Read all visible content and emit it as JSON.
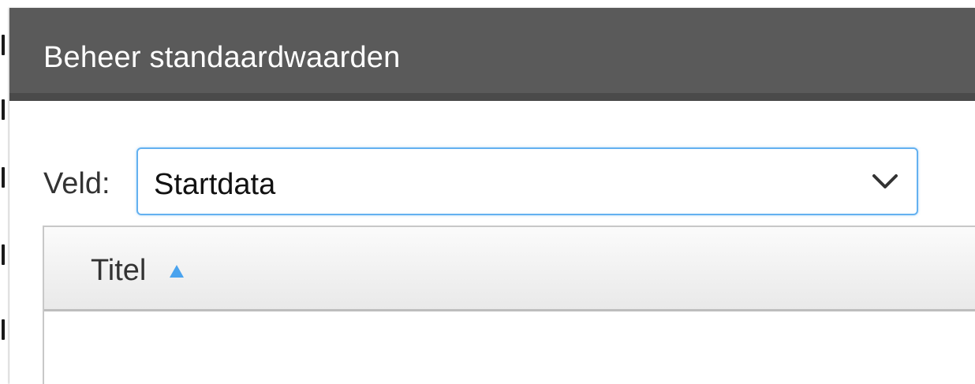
{
  "dialog": {
    "title": "Beheer standaardwaarden"
  },
  "field": {
    "label": "Veld:",
    "selected": "Startdata",
    "dropdown_icon": "chevron-down-icon"
  },
  "grid": {
    "columns": [
      {
        "label": "Titel",
        "sort": "ascending",
        "sort_icon": "sort-ascending-icon"
      }
    ],
    "rows": []
  },
  "colors": {
    "header_bg": "#5a5a5a",
    "focus_border": "#64b1f0",
    "sort_accent": "#4aa3ee"
  }
}
